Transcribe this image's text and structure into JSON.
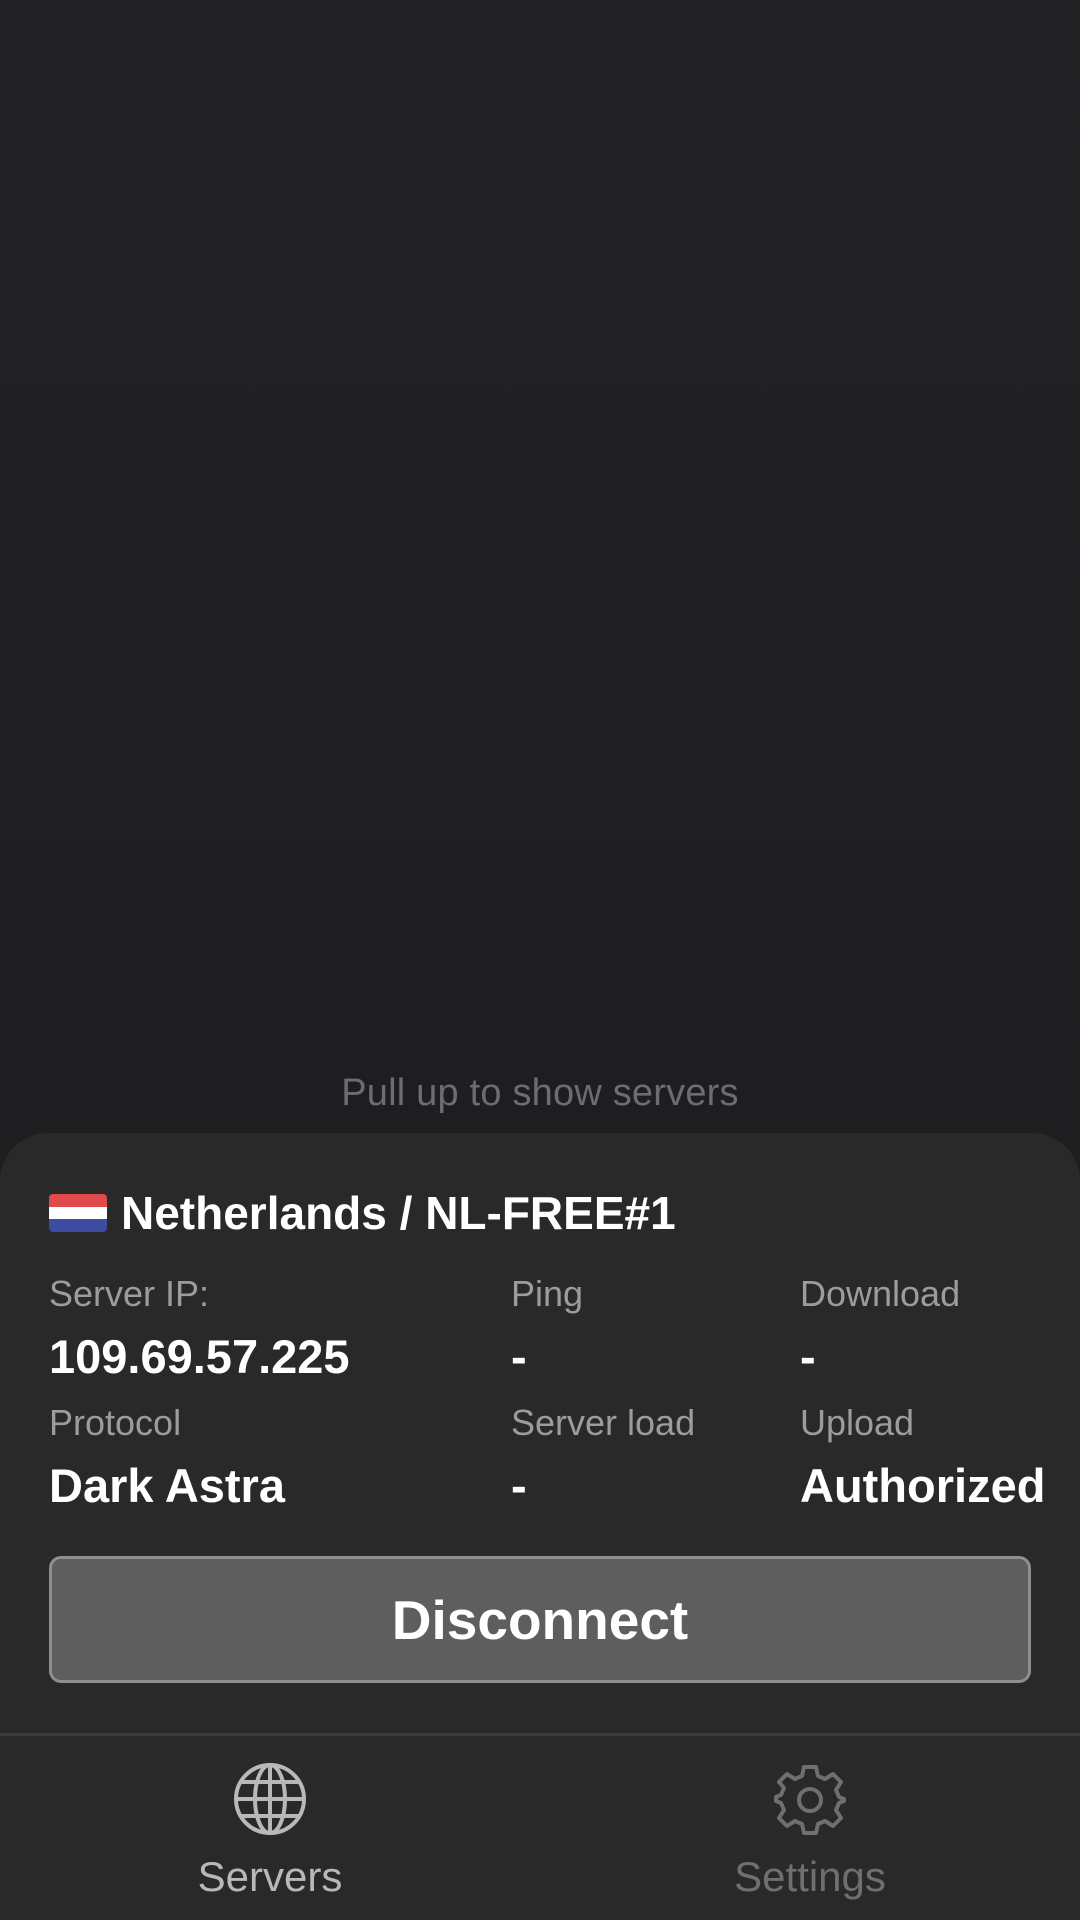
{
  "hint": "Pull up to show servers",
  "server": {
    "title": "Netherlands / NL-FREE#1",
    "flag_colors": [
      "#e04a4a",
      "#ffffff",
      "#3d4ba0"
    ],
    "stats": {
      "server_ip_label": "Server IP:",
      "server_ip": "109.69.57.225",
      "ping_label": "Ping",
      "ping": "-",
      "download_label": "Download",
      "download": "-",
      "protocol_label": "Protocol",
      "protocol": "Dark Astra",
      "load_label": "Server load",
      "load": "-",
      "upload_label": "Upload",
      "upload": "Authorized"
    },
    "disconnect_label": "Disconnect"
  },
  "nav": {
    "servers_label": "Servers",
    "servers_icon": "globe-icon",
    "settings_label": "Settings",
    "settings_icon": "gear-icon"
  }
}
